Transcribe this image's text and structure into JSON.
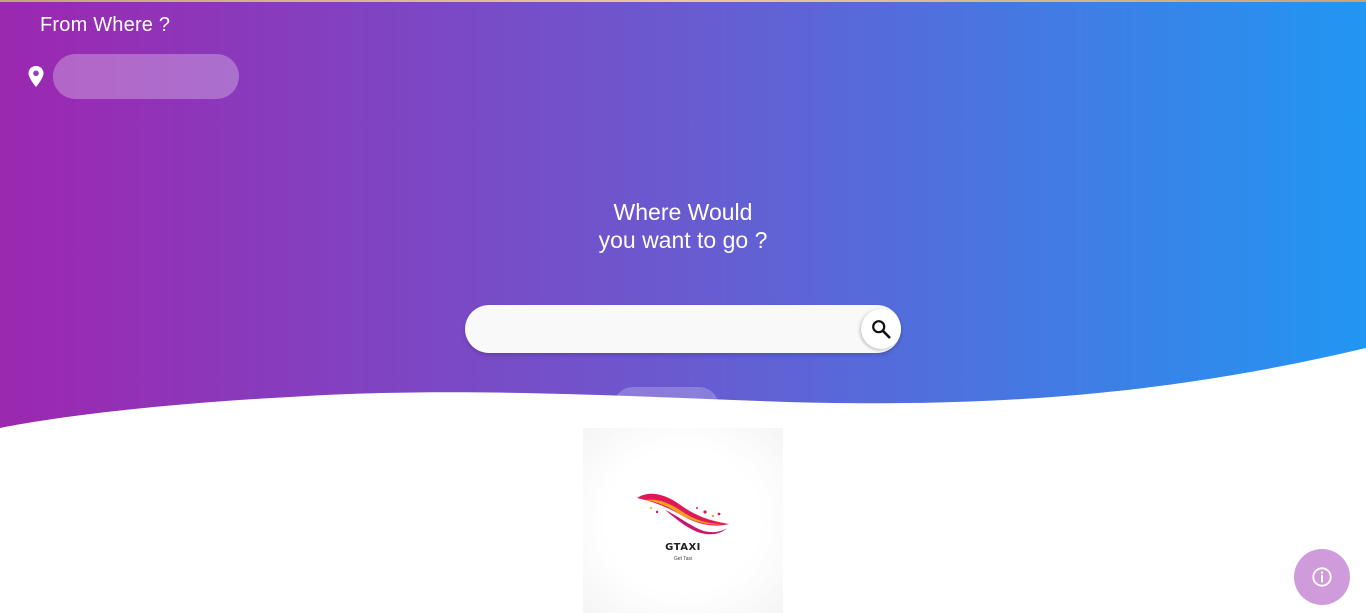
{
  "from": {
    "label": "From Where ?",
    "input_value": "",
    "pin_icon": "location-pin-icon"
  },
  "headline": {
    "line1": "Where Would",
    "line2": "you want to go ?"
  },
  "search": {
    "value": "",
    "icon": "search-icon"
  },
  "go_button": {
    "label": ""
  },
  "logo": {
    "name": "GTAXI",
    "tagline": "Get Taxi"
  },
  "info_button": {
    "icon": "info-icon"
  },
  "colors": {
    "gradient_start": "#9c27b0",
    "gradient_end": "#2196f3",
    "info_fab": "#cf9bdb"
  }
}
